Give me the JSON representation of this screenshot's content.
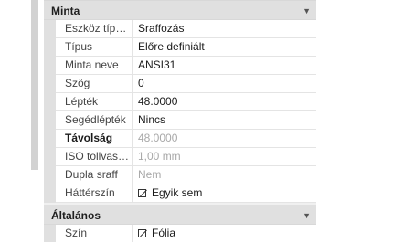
{
  "sections": {
    "minta": {
      "title": "Minta",
      "rows": [
        {
          "label": "Eszköz típusa",
          "value": "Sraffozás"
        },
        {
          "label": "Típus",
          "value": "Előre definiált"
        },
        {
          "label": "Minta neve",
          "value": "ANSI31"
        },
        {
          "label": "Szög",
          "value": "0"
        },
        {
          "label": "Lépték",
          "value": "48.0000"
        },
        {
          "label": "Segédlépték",
          "value": "Nincs"
        },
        {
          "label": "Távolság",
          "value": "48.0000"
        },
        {
          "label": "ISO tollvasta...",
          "value": "1,00 mm"
        },
        {
          "label": "Dupla sraff",
          "value": "Nem"
        },
        {
          "label": "Háttérszín",
          "value": "Egyik sem"
        }
      ]
    },
    "altalanos": {
      "title": "Általános",
      "rows": [
        {
          "label": "Szín",
          "value": "Fólia"
        }
      ]
    }
  }
}
